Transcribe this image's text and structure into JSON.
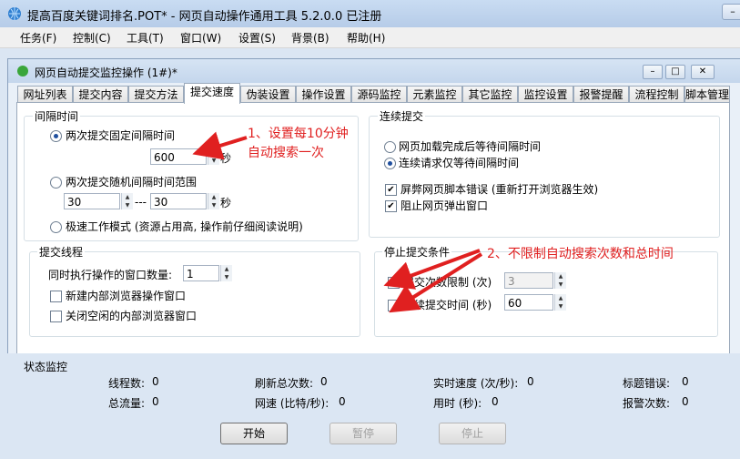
{
  "app": {
    "title": "提高百度关键词排名.POT* - 网页自动操作通用工具 5.2.0.0 已注册"
  },
  "window_controls": {
    "minimize": "–",
    "maximize": "□",
    "close": "✕"
  },
  "menu": [
    "任务(F)",
    "控制(C)",
    "工具(T)",
    "窗口(W)",
    "设置(S)",
    "背景(B)",
    "帮助(H)"
  ],
  "child": {
    "title": "网页自动提交监控操作 (1#)*"
  },
  "tabs": [
    "网址列表",
    "提交内容",
    "提交方法",
    "提交速度",
    "伪装设置",
    "操作设置",
    "源码监控",
    "元素监控",
    "其它监控",
    "监控设置",
    "报警提醒",
    "流程控制",
    "脚本管理"
  ],
  "active_tab": "提交速度",
  "interval": {
    "title": "间隔时间",
    "fixed_label": "两次提交固定间隔时间",
    "fixed_value": "600",
    "sec": "秒",
    "random_label": "两次提交随机间隔时间范围",
    "random_min": "30",
    "random_sep": "---",
    "random_max": "30",
    "turbo_label": "极速工作模式 (资源占用高, 操作前仔细阅读说明)"
  },
  "continuous": {
    "title": "连续提交",
    "opt1": "网页加载完成后等待间隔时间",
    "opt2": "连续请求仅等待间隔时间",
    "chk1": "屏弊网页脚本错误 (重新打开浏览器生效)",
    "chk2": "阻止网页弹出窗口"
  },
  "threads": {
    "title": "提交线程",
    "concurrent_label": "同时执行操作的窗口数量:",
    "concurrent_value": "1",
    "chk1": "新建内部浏览器操作窗口",
    "chk2": "关闭空闲的内部浏览器窗口"
  },
  "stop": {
    "title": "停止提交条件",
    "count_label": "提交次数限制 (次)",
    "count_value": "3",
    "time_label": "持续提交时间 (秒)",
    "time_value": "60"
  },
  "annotations": {
    "note1_line1": "1、设置每10分钟",
    "note1_line2": "自动搜索一次",
    "note2": "2、不限制自动搜索次数和总时间"
  },
  "status": {
    "title": "状态监控",
    "threads_label": "线程数:",
    "threads_value": "0",
    "refresh_label": "刷新总次数:",
    "refresh_value": "0",
    "speed_label": "实时速度 (次/秒):",
    "speed_value": "0",
    "title_err_label": "标题错误:",
    "title_err_value": "0",
    "traffic_label": "总流量:",
    "traffic_value": "0",
    "netspeed_label": "网速 (比特/秒):",
    "netspeed_value": "0",
    "elapsed_label": "用时 (秒):",
    "elapsed_value": "0",
    "alarm_label": "报警次数:",
    "alarm_value": "0"
  },
  "buttons": {
    "start": "开始",
    "pause": "暂停",
    "stop": "停止"
  }
}
